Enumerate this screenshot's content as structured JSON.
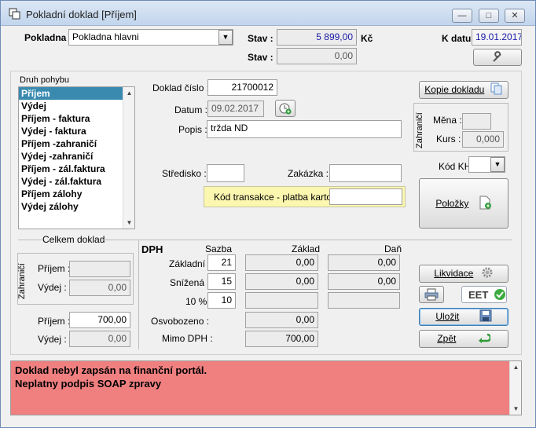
{
  "window": {
    "title": "Pokladní doklad [Příjem]",
    "minimize": "—",
    "maximize": "□",
    "close": "✕"
  },
  "header": {
    "pokladna_label": "Pokladna :",
    "pokladna_value": "Pokladna hlavni",
    "stav_label": "Stav :",
    "stav_value": "5 899,00",
    "currency": "Kč",
    "stav2_label": "Stav :",
    "stav2_value": "0,00",
    "kdatu_label": "K datu :",
    "kdatu_value": "19.01.2017"
  },
  "druh_pohybu": {
    "label": "Druh pohybu",
    "items": [
      "Příjem",
      "Výdej",
      "Příjem - faktura",
      "Výdej - faktura",
      "Příjem -zahraničí",
      "Výdej -zahraničí",
      "Příjem - zál.faktura",
      "Výdej - zál.faktura",
      "Příjem zálohy",
      "Výdej zálohy"
    ],
    "selected_index": 0
  },
  "doklad": {
    "cislo_label": "Doklad číslo :",
    "cislo_value": "21700012",
    "datum_label": "Datum :",
    "datum_value": "09.02.2017",
    "popis_label": "Popis :",
    "popis_value": "tržda ND",
    "stredisko_label": "Středisko :",
    "stredisko_value": "",
    "zakazka_label": "Zakázka :",
    "zakazka_value": "",
    "kod_transakce_label": "Kód transakce - platba kartou",
    "kod_transakce_value": ""
  },
  "right_panel": {
    "kopie_label": "Kopie dokladu",
    "zahranici_label": "Zahraničí",
    "mena_label": "Měna :",
    "mena_value": "",
    "kurs_label": "Kurs :",
    "kurs_value": "0,000",
    "kodkh_label": "Kód KH",
    "kodkh_value": "",
    "polozky_label": "Položky"
  },
  "celkem": {
    "label": "Celkem doklad",
    "zahranici_label": "Zahraničí",
    "prijem_z_label": "Příjem :",
    "prijem_z_value": "",
    "vydej_z_label": "Výdej :",
    "vydej_z_value": "0,00",
    "prijem_label": "Příjem :",
    "prijem_value": "700,00",
    "vydej_label": "Výdej :",
    "vydej_value": "0,00"
  },
  "dph": {
    "title": "DPH",
    "col_sazba": "Sazba",
    "col_zaklad": "Základ",
    "col_dan": "Daň",
    "rows": [
      {
        "label": "Základní :",
        "sazba": "21",
        "zaklad": "0,00",
        "dan": "0,00"
      },
      {
        "label": "Snížená :",
        "sazba": "15",
        "zaklad": "0,00",
        "dan": "0,00"
      },
      {
        "label": "10 %",
        "sazba": "10",
        "zaklad": "",
        "dan": ""
      }
    ],
    "osvobozeno_label": "Osvobozeno :",
    "osvobozeno_value": "0,00",
    "mimo_label": "Mimo DPH :",
    "mimo_value": "700,00"
  },
  "actions": {
    "likvidace": "Likvidace",
    "eet": "EET",
    "ulozit": "Uložit",
    "zpet": "Zpět"
  },
  "message": {
    "line1": "Doklad nebyl zapsán na finanční portál.",
    "line2": "Neplatny podpis SOAP zpravy"
  }
}
